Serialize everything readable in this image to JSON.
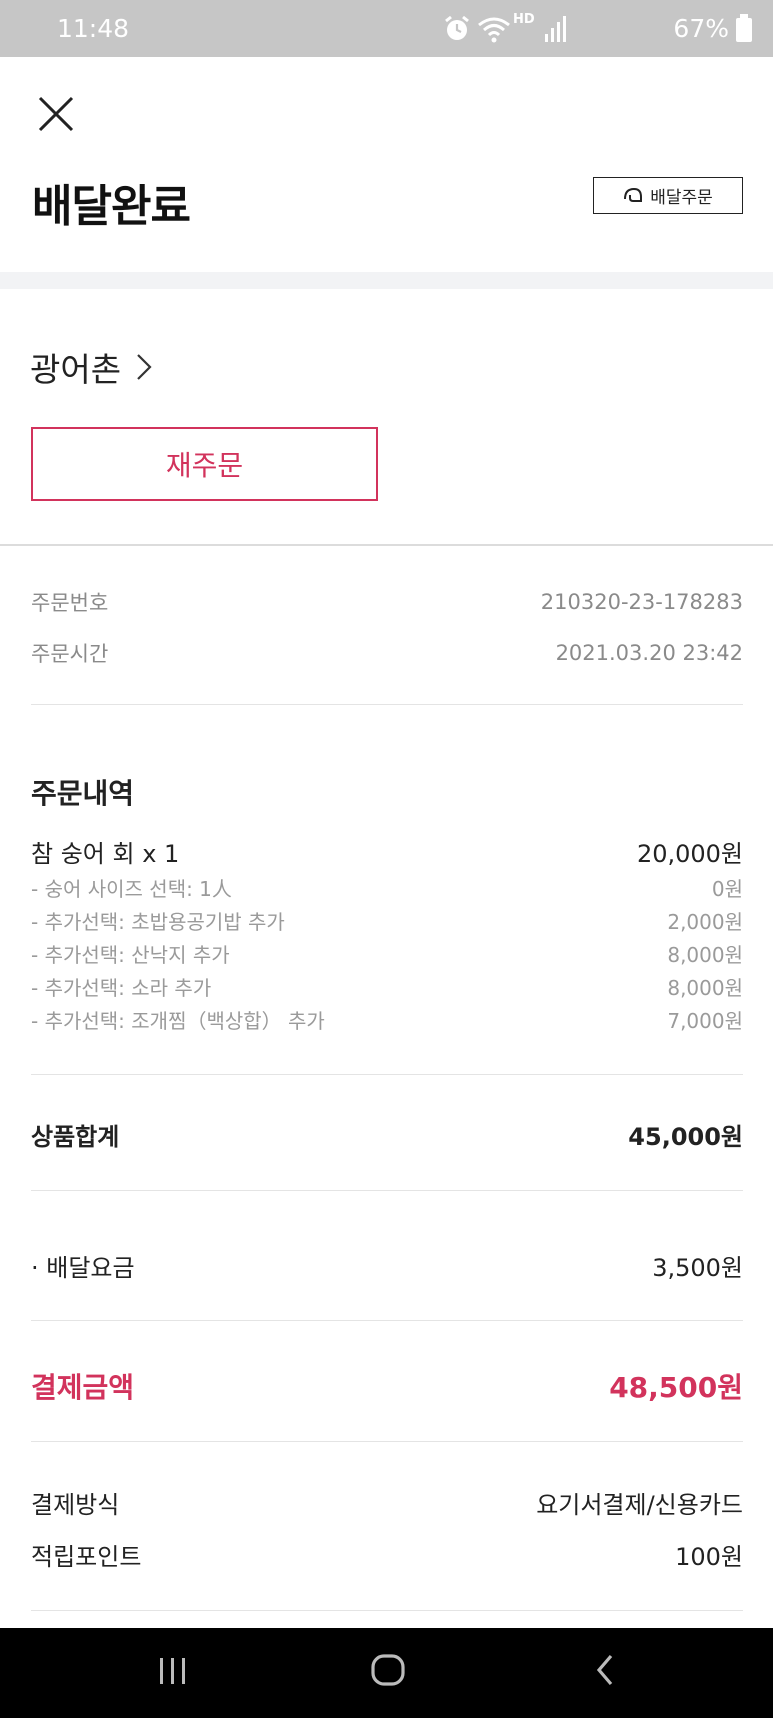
{
  "status_bar": {
    "time": "11:48",
    "hd_label": "HD",
    "battery": "67%"
  },
  "header": {
    "title": "배달완료",
    "order_type_label": "배달주문"
  },
  "store": {
    "name": "광어촌",
    "reorder_label": "재주문"
  },
  "order_meta": {
    "order_number_label": "주문번호",
    "order_number": "210320-23-178283",
    "order_time_label": "주문시간",
    "order_time": "2021.03.20 23:42"
  },
  "order_details": {
    "title": "주문내역",
    "item": {
      "name": "참 숭어 회 x 1",
      "price": "20,000원"
    },
    "options": [
      {
        "label": "- 숭어 사이즈 선택: 1人",
        "price": "0원"
      },
      {
        "label": "- 추가선택: 초밥용공기밥 추가",
        "price": "2,000원"
      },
      {
        "label": "- 추가선택: 산낙지 추가",
        "price": "8,000원"
      },
      {
        "label": "- 추가선택: 소라 추가",
        "price": "8,000원"
      },
      {
        "label": "- 추가선택: 조개찜（백상합） 추가",
        "price": "7,000원"
      }
    ]
  },
  "summary": {
    "subtotal_label": "상품합계",
    "subtotal": "45,000원",
    "delivery_fee_label": "· 배달요금",
    "delivery_fee": "3,500원",
    "total_label": "결제금액",
    "total": "48,500원"
  },
  "payment": {
    "method_label": "결제방식",
    "method": "요기서결제/신용카드",
    "points_label": "적립포인트",
    "points": "100원"
  },
  "colors": {
    "accent": "#d2335c",
    "status_bar": "#c6c6c6",
    "nav_bar": "#000000"
  }
}
